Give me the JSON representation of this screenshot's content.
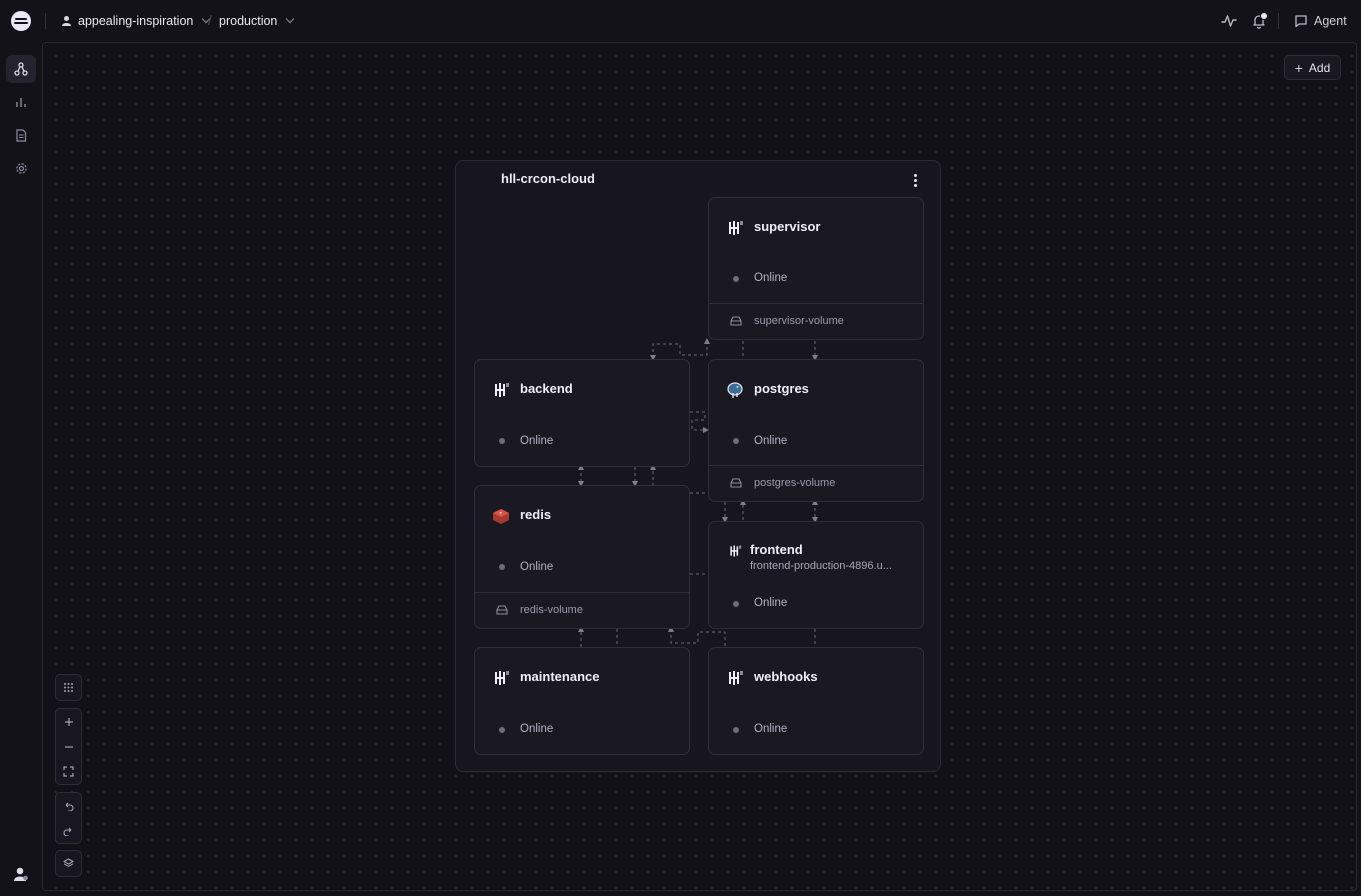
{
  "topbar": {
    "project_name": "appealing-inspiration",
    "environment_name": "production",
    "agent_label": "Agent",
    "icons": [
      "activity-icon",
      "bell-icon",
      "chat-icon"
    ]
  },
  "sidebar": {
    "items": [
      {
        "name": "architecture",
        "icon": "architecture-icon",
        "active": true
      },
      {
        "name": "observability",
        "icon": "chart-icon",
        "active": false
      },
      {
        "name": "logs",
        "icon": "document-icon",
        "active": false
      },
      {
        "name": "settings",
        "icon": "gear-icon",
        "active": false
      }
    ]
  },
  "canvas": {
    "add_label": "Add",
    "group": {
      "title": "hll-crcon-cloud",
      "services": [
        {
          "name": "supervisor",
          "icon": "service-icon",
          "status": "Online",
          "volume": "supervisor-volume"
        },
        {
          "name": "backend",
          "icon": "service-icon",
          "status": "Online"
        },
        {
          "name": "postgres",
          "icon": "postgres-elephant-icon",
          "status": "Online",
          "volume": "postgres-volume"
        },
        {
          "name": "redis",
          "icon": "redis-icon",
          "status": "Online",
          "volume": "redis-volume"
        },
        {
          "name": "frontend",
          "icon": "service-icon",
          "subtitle": "frontend-production-4896.u...",
          "status": "Online"
        },
        {
          "name": "maintenance",
          "icon": "service-icon",
          "status": "Online"
        },
        {
          "name": "webhooks",
          "icon": "service-icon",
          "status": "Online"
        }
      ]
    }
  },
  "colors": {
    "background": "#131219",
    "card": "#1a1921",
    "border": "#302e3a",
    "text": "#efedf6",
    "muted": "#b4b1c0"
  }
}
